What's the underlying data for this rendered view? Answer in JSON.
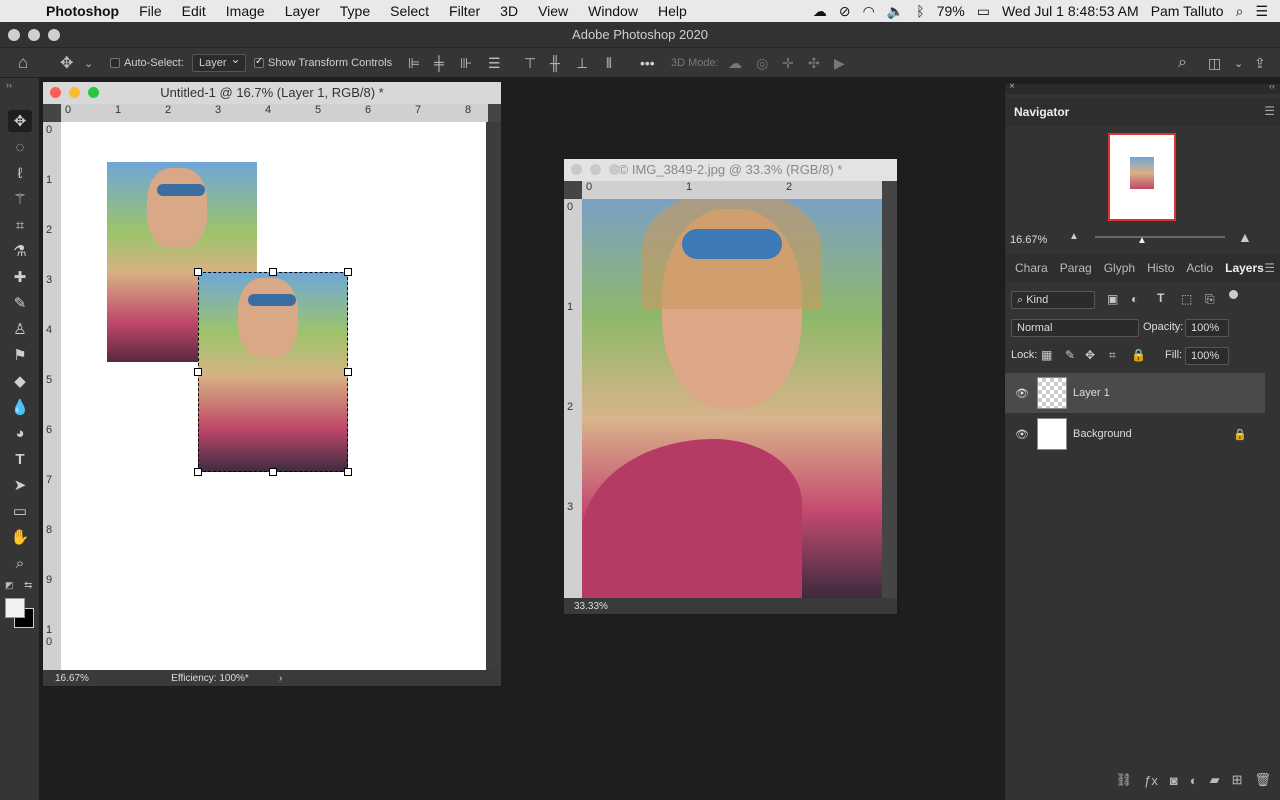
{
  "menubar": {
    "app_name": "Photoshop",
    "items": [
      "File",
      "Edit",
      "Image",
      "Layer",
      "Type",
      "Select",
      "Filter",
      "3D",
      "View",
      "Window",
      "Help"
    ],
    "battery": "79%",
    "datetime": "Wed Jul 1  8:48:53 AM",
    "user": "Pam Talluto"
  },
  "window_title": "Adobe Photoshop 2020",
  "options_bar": {
    "auto_select_label": "Auto-Select:",
    "auto_select_value": "Layer",
    "show_transform_label": "Show Transform Controls",
    "mode_3d_label": "3D Mode:",
    "more_label": "•••"
  },
  "doc1": {
    "title": "Untitled-1 @ 16.7% (Layer 1, RGB/8) *",
    "zoom": "16.67%",
    "efficiency": "Efficiency: 100%*",
    "ruler_h": [
      "0",
      "1",
      "2",
      "3",
      "4",
      "5",
      "6",
      "7",
      "8"
    ],
    "ruler_v": [
      "0",
      "1",
      "2",
      "3",
      "4",
      "5",
      "6",
      "7",
      "8",
      "9",
      "1",
      "0"
    ]
  },
  "doc2": {
    "title": "© IMG_3849-2.jpg @ 33.3% (RGB/8) *",
    "zoom": "33.33%",
    "ruler_h": [
      "0",
      "1",
      "2"
    ],
    "ruler_v": [
      "0",
      "1",
      "2",
      "3"
    ]
  },
  "navigator": {
    "title": "Navigator",
    "zoom": "16.67%"
  },
  "panel_tabs": [
    "Chara",
    "Parag",
    "Glyph",
    "Histo",
    "Actio",
    "Layers"
  ],
  "layers_panel": {
    "filter_kind": "Kind",
    "blend_mode": "Normal",
    "opacity_label": "Opacity:",
    "opacity_value": "100%",
    "lock_label": "Lock:",
    "fill_label": "Fill:",
    "fill_value": "100%",
    "layers": [
      {
        "name": "Layer 1",
        "visible": true,
        "selected": true
      },
      {
        "name": "Background",
        "visible": true,
        "locked": true
      }
    ]
  },
  "colors": {
    "accent_selected": "#4a4a4a",
    "ui_bg": "#353535",
    "workspace": "#1e1e1e"
  }
}
